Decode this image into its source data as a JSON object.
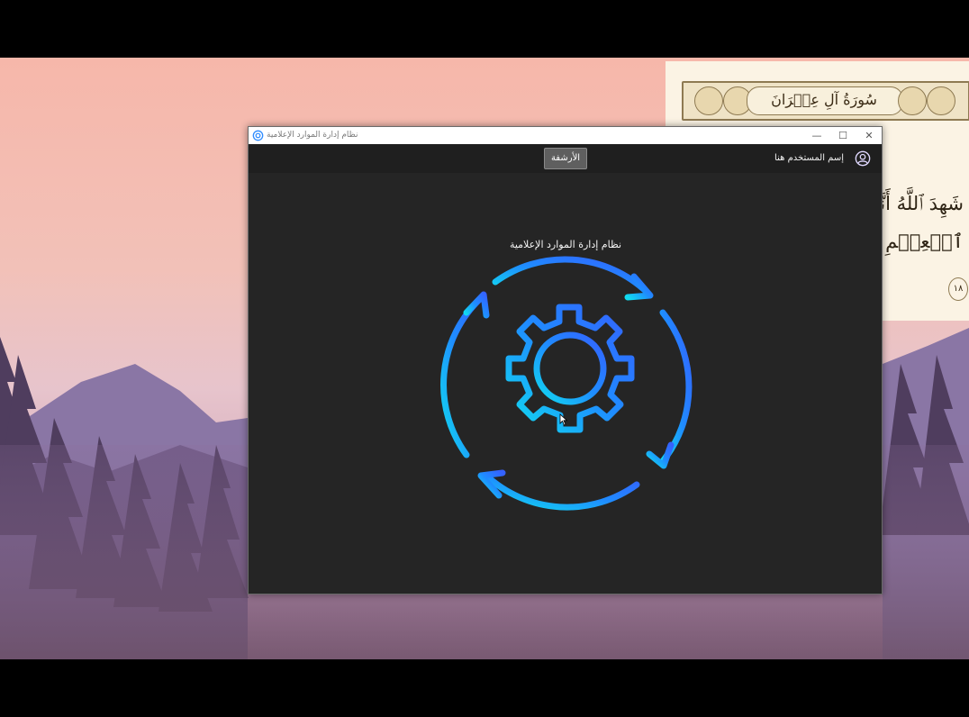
{
  "window": {
    "title": "نظام إدارة الموارد الإعلامية",
    "controls": {
      "minimize": "—",
      "maximize": "☐",
      "close": "✕"
    }
  },
  "appbar": {
    "archive_button": "الأرشفة",
    "username": "إسم المستخدم هنا"
  },
  "main": {
    "system_title": "نظام إدارة الموارد الإعلامية"
  },
  "background_quran": {
    "surah_title": "سُورَةُ آلِ عِمۡرَانَ",
    "line1": "شَهِدَ ٱللَّهُ أَنَّهُۥ لَآ",
    "line2": "ٱلۡعِلۡمِ قَآئِمَۢا بِٱلۡقِ",
    "ayah_number": "١٨"
  },
  "colors": {
    "gradient_start": "#2f6bff",
    "gradient_end": "#12d8f0",
    "window_bg": "#252525",
    "appbar_bg": "#1f1f1f"
  },
  "icons": {
    "app": "gear-app-icon",
    "user": "user-circle-icon",
    "hero": "gear-refresh-icon"
  }
}
